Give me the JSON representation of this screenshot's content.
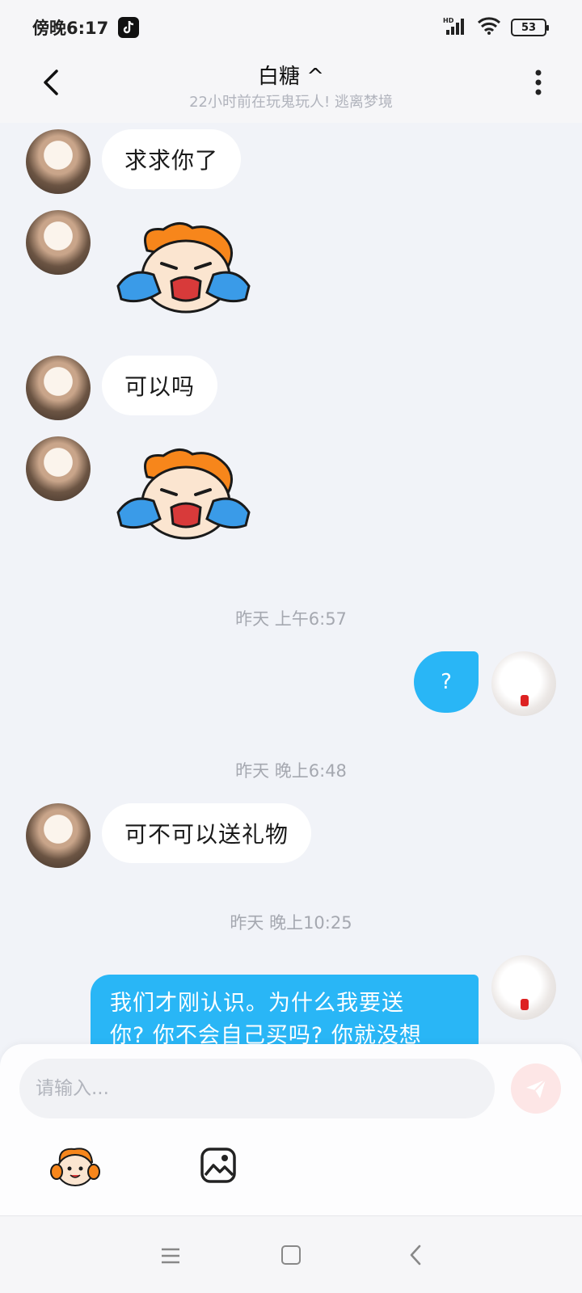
{
  "status_bar": {
    "time": "傍晚6:17",
    "battery": "53",
    "network": "HD"
  },
  "header": {
    "title": "白糖 ^",
    "subtitle": "22小时前在玩鬼玩人! 逃离梦境"
  },
  "messages": [
    {
      "type": "text",
      "side": "in",
      "text": "求求你了"
    },
    {
      "type": "sticker",
      "side": "in",
      "sticker": "crying-mascot-sticker"
    },
    {
      "type": "text",
      "side": "in",
      "text": "可以吗"
    },
    {
      "type": "sticker",
      "side": "in",
      "sticker": "crying-mascot-sticker"
    },
    {
      "type": "timestamp",
      "text": "昨天 上午6:57"
    },
    {
      "type": "text",
      "side": "out",
      "text": "?"
    },
    {
      "type": "timestamp",
      "text": "昨天 晚上6:48"
    },
    {
      "type": "text",
      "side": "in",
      "text": "可不可以送礼物"
    },
    {
      "type": "timestamp",
      "text": "昨天 晚上10:25"
    },
    {
      "type": "text",
      "side": "out",
      "line1": "我们才刚认识。为什么我要送",
      "line2": "你? 你不会自己买吗? 你就没想"
    }
  ],
  "composer": {
    "placeholder": "请输入..."
  },
  "colors": {
    "accent": "#29b6f6",
    "background": "#f1f3f8",
    "send_disabled": "#fde6e6"
  }
}
